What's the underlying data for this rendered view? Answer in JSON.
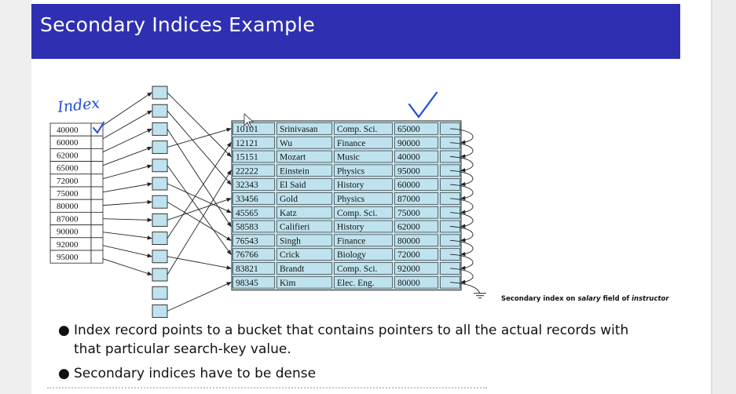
{
  "slide": {
    "title": "Secondary Indices Example"
  },
  "index_keys": [
    "40000",
    "60000",
    "62000",
    "65000",
    "72000",
    "75000",
    "80000",
    "87000",
    "90000",
    "92000",
    "95000"
  ],
  "bucket_count": 13,
  "records": [
    {
      "id": "10101",
      "name": "Srinivasan",
      "dept": "Comp. Sci.",
      "salary": "65000"
    },
    {
      "id": "12121",
      "name": "Wu",
      "dept": "Finance",
      "salary": "90000"
    },
    {
      "id": "15151",
      "name": "Mozart",
      "dept": "Music",
      "salary": "40000"
    },
    {
      "id": "22222",
      "name": "Einstein",
      "dept": "Physics",
      "salary": "95000"
    },
    {
      "id": "32343",
      "name": "El Said",
      "dept": "History",
      "salary": "60000"
    },
    {
      "id": "33456",
      "name": "Gold",
      "dept": "Physics",
      "salary": "87000"
    },
    {
      "id": "45565",
      "name": "Katz",
      "dept": "Comp. Sci.",
      "salary": "75000"
    },
    {
      "id": "58583",
      "name": "Califieri",
      "dept": "History",
      "salary": "62000"
    },
    {
      "id": "76543",
      "name": "Singh",
      "dept": "Finance",
      "salary": "80000"
    },
    {
      "id": "76766",
      "name": "Crick",
      "dept": "Biology",
      "salary": "72000"
    },
    {
      "id": "83821",
      "name": "Brandt",
      "dept": "Comp. Sci.",
      "salary": "92000"
    },
    {
      "id": "98345",
      "name": "Kim",
      "dept": "Elec. Eng.",
      "salary": "80000"
    }
  ],
  "caption": {
    "prefix": "Secondary index on ",
    "field": "salary",
    "middle": " field of ",
    "relation": "instructor"
  },
  "annotation": {
    "handwritten_label": "Index",
    "color": "#1f4fd6"
  },
  "colors": {
    "title_bar": "#2f2fb2",
    "bucket_fill": "#bfe3ee",
    "table_fill": "#bfe3ee"
  },
  "bullets": [
    "Index record points to a bucket that contains pointers to all the actual records with that particular search-key value.",
    "Secondary indices have to be dense"
  ]
}
